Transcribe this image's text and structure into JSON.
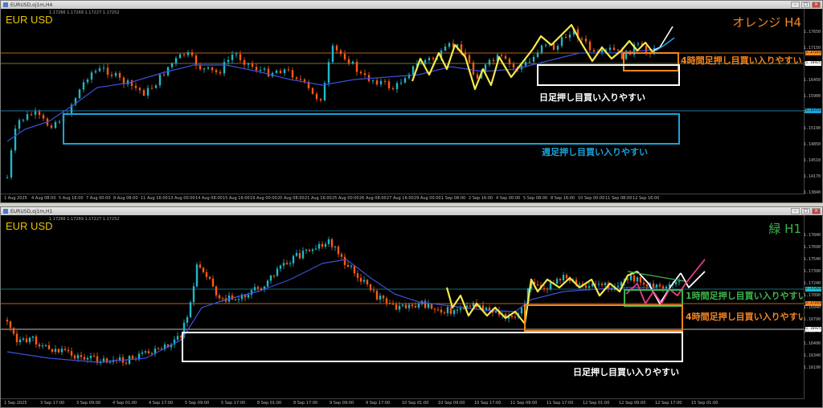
{
  "top": {
    "window_title": "EURUSD,oj1m,H4",
    "ohlc": "1.17266 1.17269 1.17227 1.17252",
    "symbol": "EUR USD",
    "timeframe_label": "オレンジ H4",
    "timeframe_color": "#f5851f",
    "price_ticks": [
      "1.17650",
      "1.17150",
      "1.16925",
      "1.16450",
      "1.15900",
      "1.15530",
      "1.15190",
      "1.14850",
      "1.14510",
      "1.14170",
      "1.13840"
    ],
    "price_tags": [
      {
        "text": "1.17231",
        "color": "#f5851f"
      },
      {
        "text": "1.16925",
        "color": "#ffffff"
      },
      {
        "text": "1.15755",
        "color": "#1aa3d9"
      }
    ],
    "time_ticks": [
      "1 Aug 2025",
      "4 Aug 08:00",
      "5 Aug 16:00",
      "7 Aug 00:00",
      "8 Aug 08:00",
      "11 Aug 16:00",
      "13 Aug 00:00",
      "14 Aug 08:00",
      "15 Aug 16:00",
      "19 Aug 00:00",
      "20 Aug 08:00",
      "21 Aug 16:00",
      "25 Aug 00:00",
      "26 Aug 08:00",
      "27 Aug 16:00",
      "29 Aug 00:00",
      "1 Sep 08:00",
      "2 Sep 16:00",
      "4 Sep 00:00",
      "5 Sep 08:00",
      "8 Sep 16:00",
      "10 Sep 00:00",
      "11 Sep 08:00",
      "12 Sep 16:00"
    ],
    "annotations": {
      "h4": "4時間足押し目買い入りやすい",
      "daily": "日足押し目買い入りやすい",
      "weekly": "週足押し目買い入りやすい"
    },
    "colors": {
      "orange": "#f5851f",
      "white": "#ffffff",
      "blue": "#1aa3d9",
      "bull": "#1fb8c8",
      "bear": "#ff5a14",
      "zigzag": "#f5e84a",
      "ma": "#3b4fd8"
    }
  },
  "bottom": {
    "window_title": "EURUSD,oj1m,H1",
    "ohlc": "1.17266 1.17269 1.17227 1.17252",
    "symbol": "EUR USD",
    "timeframe_label": "緑 H1",
    "timeframe_color": "#3cb44b",
    "price_ticks": [
      "1.17840",
      "1.17690",
      "1.17540",
      "1.17390",
      "1.17240",
      "1.17090",
      "1.16940",
      "1.16790",
      "1.16640",
      "1.16490",
      "1.16340",
      "1.16190"
    ],
    "price_tags": [
      {
        "text": "1.17265",
        "color": "#1fb8c8"
      },
      {
        "text": "1.17231",
        "color": "#f5851f"
      },
      {
        "text": "1.16925",
        "color": "#ffffff"
      }
    ],
    "time_ticks": [
      "1 Sep 2025",
      "3 Sep 17:00",
      "3 Sep 09:00",
      "4 Sep 01:00",
      "4 Sep 17:00",
      "5 Sep 09:00",
      "5 Sep 17:00",
      "8 Sep 01:00",
      "8 Sep 17:00",
      "9 Sep 09:00",
      "9 Sep 17:00",
      "10 Sep 01:00",
      "10 Sep 09:00",
      "10 Sep 17:00",
      "11 Sep 09:00",
      "11 Sep 17:00",
      "12 Sep 01:00",
      "12 Sep 09:00",
      "12 Sep 17:00",
      "15 Sep 01:00"
    ],
    "annotations": {
      "h1": "1時間足押し目買い入りやすい",
      "h4": "4時間足押し目買い入りやすい",
      "daily": "日足押し目買い入りやすい"
    },
    "colors": {
      "green": "#3cb44b",
      "orange": "#f5851f",
      "white": "#ffffff",
      "pink": "#e83e8c",
      "bull": "#1fb8c8",
      "bear": "#ff5a14",
      "zigzag": "#f5e84a",
      "ma": "#3b4fd8"
    }
  }
}
